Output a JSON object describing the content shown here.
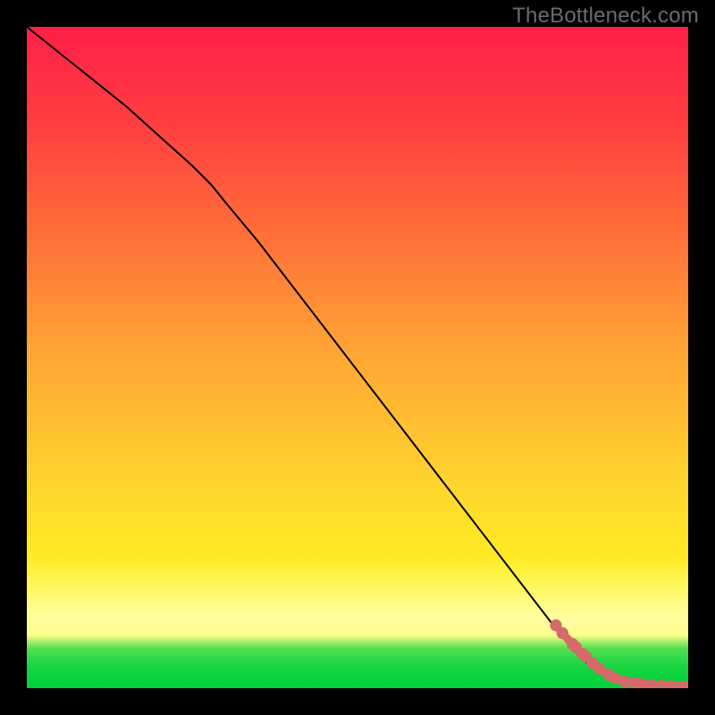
{
  "watermark": "TheBottleneck.com",
  "chart_data": {
    "type": "line",
    "title": "",
    "xlabel": "",
    "ylabel": "",
    "xlim": [
      0,
      100
    ],
    "ylim": [
      0,
      100
    ],
    "grid": false,
    "series": [
      {
        "name": "curve",
        "style": "solid-black",
        "x": [
          0,
          5,
          10,
          15,
          20,
          25,
          28,
          30,
          35,
          40,
          45,
          50,
          55,
          60,
          65,
          70,
          75,
          80,
          82,
          85,
          88,
          90,
          92,
          94,
          96,
          98,
          100
        ],
        "y": [
          100,
          96,
          92,
          88,
          83.5,
          79,
          76,
          73.5,
          67.5,
          61,
          54.5,
          48,
          41.5,
          35,
          28.5,
          22,
          15.5,
          9,
          6.5,
          3.5,
          1.5,
          1.0,
          0.7,
          0.5,
          0.3,
          0.2,
          0.2
        ]
      },
      {
        "name": "points",
        "style": "thick-coral-dots",
        "x": [
          80,
          81,
          82.5,
          83,
          84,
          84.5,
          85.5,
          86.5,
          88,
          89,
          90.5,
          92,
          93,
          94.5,
          96,
          97.5,
          99,
          100
        ],
        "y": [
          9.5,
          8.3,
          6.7,
          6.2,
          5.2,
          4.8,
          3.8,
          3.0,
          2.0,
          1.5,
          1.0,
          0.8,
          0.6,
          0.5,
          0.4,
          0.3,
          0.25,
          0.2
        ]
      }
    ],
    "heatmap_gradient": {
      "orientation": "vertical",
      "stops": [
        {
          "pos": 0.0,
          "color": "#ff1f47"
        },
        {
          "pos": 0.35,
          "color": "#ff7a38"
        },
        {
          "pos": 0.68,
          "color": "#ffd22f"
        },
        {
          "pos": 0.88,
          "color": "#ffffaa"
        },
        {
          "pos": 0.96,
          "color": "#7ee85d"
        },
        {
          "pos": 1.0,
          "color": "#00d23c"
        }
      ]
    }
  }
}
